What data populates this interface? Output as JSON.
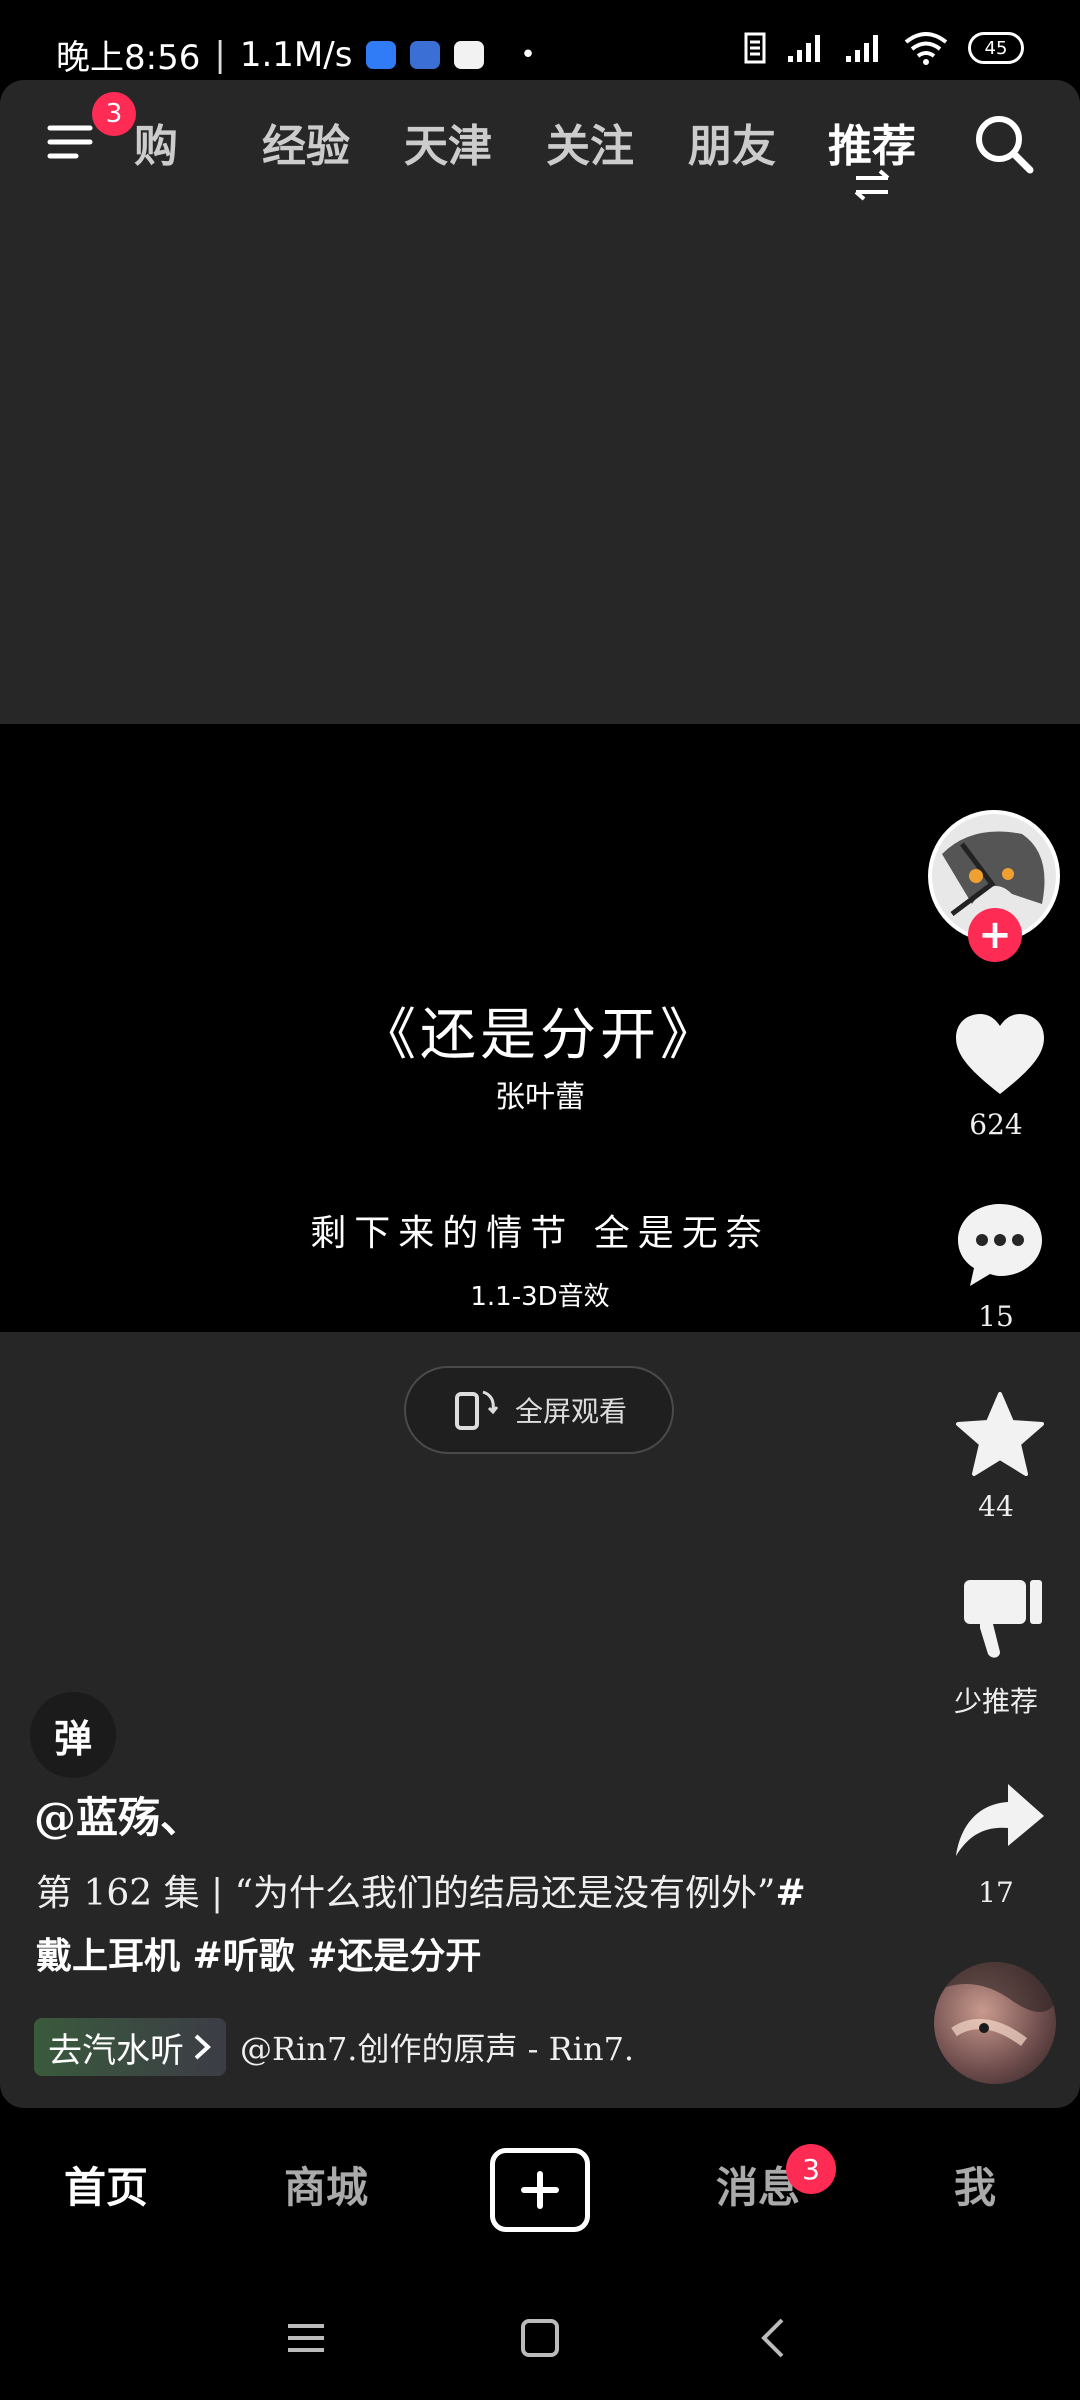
{
  "status_bar": {
    "time": "晚上8:56",
    "speed": "1.1M/s",
    "battery": "45"
  },
  "top_nav": {
    "menu_badge": "3",
    "tabs": [
      {
        "label": "团购",
        "visible": "购"
      },
      {
        "label": "经验",
        "visible": "经验"
      },
      {
        "label": "天津",
        "visible": "天津"
      },
      {
        "label": "关注",
        "visible": "关注"
      },
      {
        "label": "朋友",
        "visible": "朋友"
      },
      {
        "label": "推荐",
        "visible": "推荐"
      }
    ],
    "active_tab": "推荐"
  },
  "video": {
    "song_title": "《还是分开》",
    "singer": "张叶蕾",
    "lyric": "剩下来的情节 全是无奈",
    "effect_label": "1.1-3D音效"
  },
  "fullscreen": {
    "label": "全屏观看"
  },
  "right_rail": {
    "like_count": "624",
    "comment_count": "15",
    "favorite_count": "44",
    "dislike_label": "少推荐",
    "share_count": "17"
  },
  "danmaku": {
    "label": "弹"
  },
  "post": {
    "author": "@蓝殇、",
    "description_text": "第 162 集 | “为什么我们的结局还是没有例外”",
    "hashtags": "#戴上耳机 #听歌 #还是分开",
    "music_chip": "去汽水听",
    "music_source": "@Rin7.创作的原声 - Rin7."
  },
  "bottom_nav": {
    "home": "首页",
    "mall": "商城",
    "messages": "消息",
    "messages_badge": "3",
    "me": "我"
  }
}
